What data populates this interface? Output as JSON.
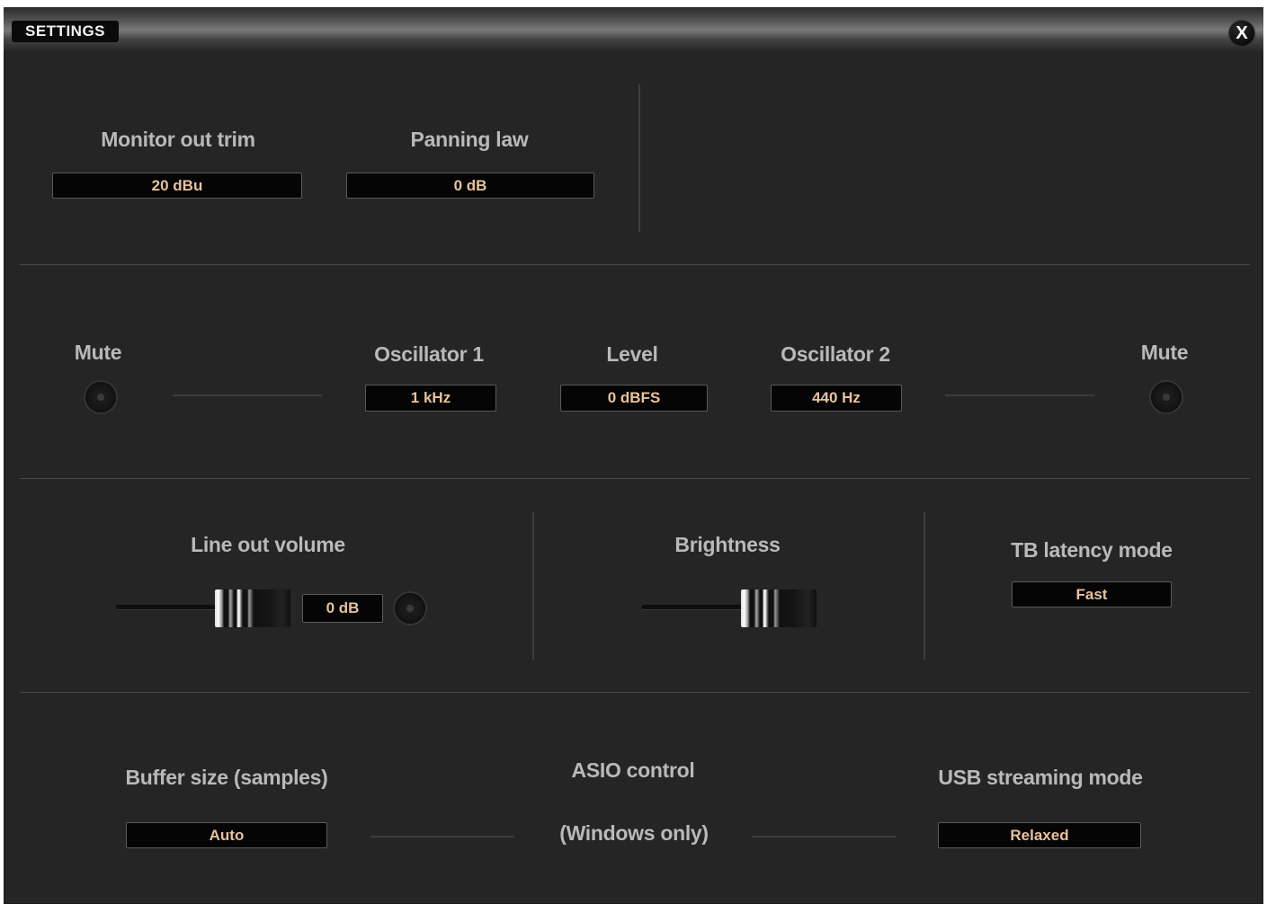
{
  "window": {
    "title": "SETTINGS",
    "close_label": "X"
  },
  "monitor": {
    "trim_label": "Monitor out trim",
    "trim_value": "20 dBu",
    "panning_label": "Panning law",
    "panning_value": "0 dB"
  },
  "oscillator": {
    "mute_left_label": "Mute",
    "mute_right_label": "Mute",
    "osc1_label": "Oscillator 1",
    "osc1_value": "1 kHz",
    "level_label": "Level",
    "level_value": "0 dBFS",
    "osc2_label": "Oscillator 2",
    "osc2_value": "440 Hz"
  },
  "output": {
    "line_out_label": "Line out volume",
    "line_out_value": "0 dB",
    "brightness_label": "Brightness",
    "tb_latency_label": "TB latency mode",
    "tb_latency_value": "Fast"
  },
  "driver": {
    "buffer_label": "Buffer size (samples)",
    "buffer_value": "Auto",
    "asio_label": "ASIO control",
    "asio_note": "(Windows only)",
    "usb_label": "USB streaming mode",
    "usb_value": "Relaxed"
  },
  "colors": {
    "background": "#252525",
    "label": "#b9b9b9",
    "value_text": "#e7c29d",
    "field_bg": "#050505"
  }
}
